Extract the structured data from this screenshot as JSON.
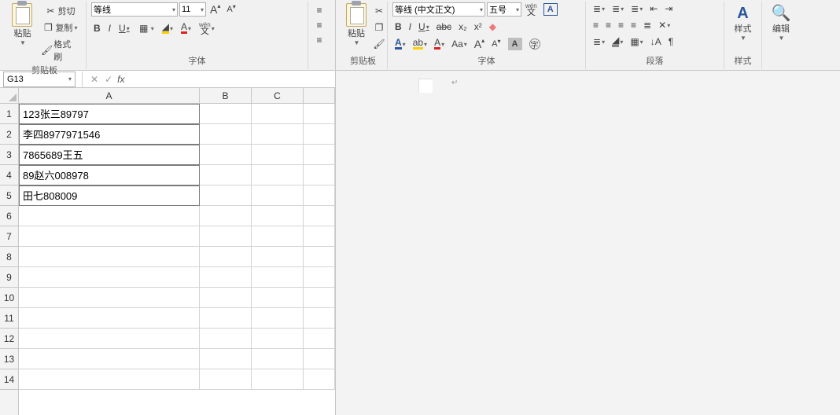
{
  "excel": {
    "clipboard": {
      "title": "剪贴板",
      "paste": "粘贴",
      "cut": "剪切",
      "copy": "复制",
      "format_painter": "格式刷"
    },
    "font": {
      "title": "字体",
      "name_selected": "等线",
      "size_selected": "11",
      "increase": "A",
      "decrease": "A",
      "bold": "B",
      "italic": "I",
      "underline": "U",
      "phonetic_pinyin": "wén",
      "phonetic_char": "文"
    },
    "namebox": {
      "ref": "G13"
    },
    "formula": {
      "fx": "fx",
      "value": ""
    },
    "columns": [
      "A",
      "B",
      "C"
    ],
    "rows": [
      "1",
      "2",
      "3",
      "4",
      "5",
      "6",
      "7",
      "8",
      "9",
      "10",
      "11",
      "12",
      "13",
      "14"
    ],
    "data": {
      "A1": "123张三89797",
      "A2": "李四8977971546",
      "A3": "7865689王五",
      "A4": "89赵六008978",
      "A5": "田七808009"
    }
  },
  "word": {
    "clipboard": {
      "title": "剪贴板",
      "paste": "粘贴"
    },
    "font": {
      "title": "字体",
      "name_selected": "等线 (中文正文)",
      "size_selected": "五号",
      "phonetic_pinyin": "wén",
      "phonetic_char": "文",
      "bold": "B",
      "italic": "I",
      "underline": "U",
      "strike": "abc",
      "sub": "x₂",
      "sup": "x²",
      "grow": "A",
      "shrink": "A",
      "caseAa": "Aa",
      "boxA": "A",
      "shadeA": "A"
    },
    "paragraph": {
      "title": "段落"
    },
    "styles_group": {
      "title": "样式",
      "label": "样式"
    },
    "edit_group": {
      "title": "",
      "label": "编辑"
    },
    "doc": {
      "para_mark": "↵"
    }
  }
}
